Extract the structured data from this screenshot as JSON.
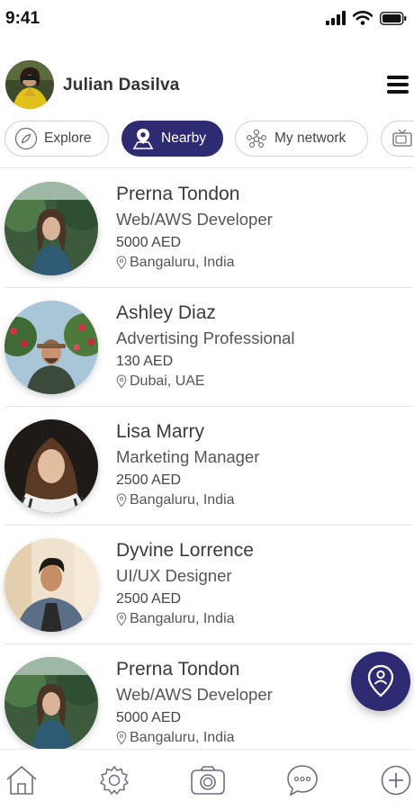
{
  "status_bar": {
    "time": "9:41",
    "icons": [
      "signal-icon",
      "wifi-icon",
      "battery-icon"
    ]
  },
  "header": {
    "user_name": "Julian Dasilva",
    "menu_icon": "hamburger-menu-icon"
  },
  "tabs": [
    {
      "label": "Explore",
      "icon": "compass-icon",
      "active": false
    },
    {
      "label": "Nearby",
      "icon": "map-pin-icon",
      "active": true
    },
    {
      "label": "My network",
      "icon": "network-icon",
      "active": false
    },
    {
      "label": "",
      "icon": "tv-icon",
      "active": false
    }
  ],
  "people": [
    {
      "name": "Prerna Tondon",
      "role": "Web/AWS Developer",
      "price": "5000 AED",
      "location": "Bangaluru, India"
    },
    {
      "name": "Ashley Diaz",
      "role": "Advertising Professional",
      "price": "130 AED",
      "location": "Dubai, UAE"
    },
    {
      "name": "Lisa Marry",
      "role": "Marketing Manager",
      "price": "2500 AED",
      "location": "Bangaluru, India"
    },
    {
      "name": "Dyvine Lorrence",
      "role": "UI/UX Designer",
      "price": "2500 AED",
      "location": "Bangaluru, India"
    },
    {
      "name": "Prerna Tondon",
      "role": "Web/AWS Developer",
      "price": "5000 AED",
      "location": "Bangaluru, India"
    }
  ],
  "fab": {
    "icon": "location-person-icon"
  },
  "bottom_nav": [
    {
      "icon": "home-icon"
    },
    {
      "icon": "settings-icon"
    },
    {
      "icon": "camera-icon"
    },
    {
      "icon": "chat-icon"
    },
    {
      "icon": "add-icon"
    }
  ],
  "colors": {
    "accent": "#2f2b72",
    "text": "#3b3b3b",
    "divider": "#e3e3e3"
  }
}
